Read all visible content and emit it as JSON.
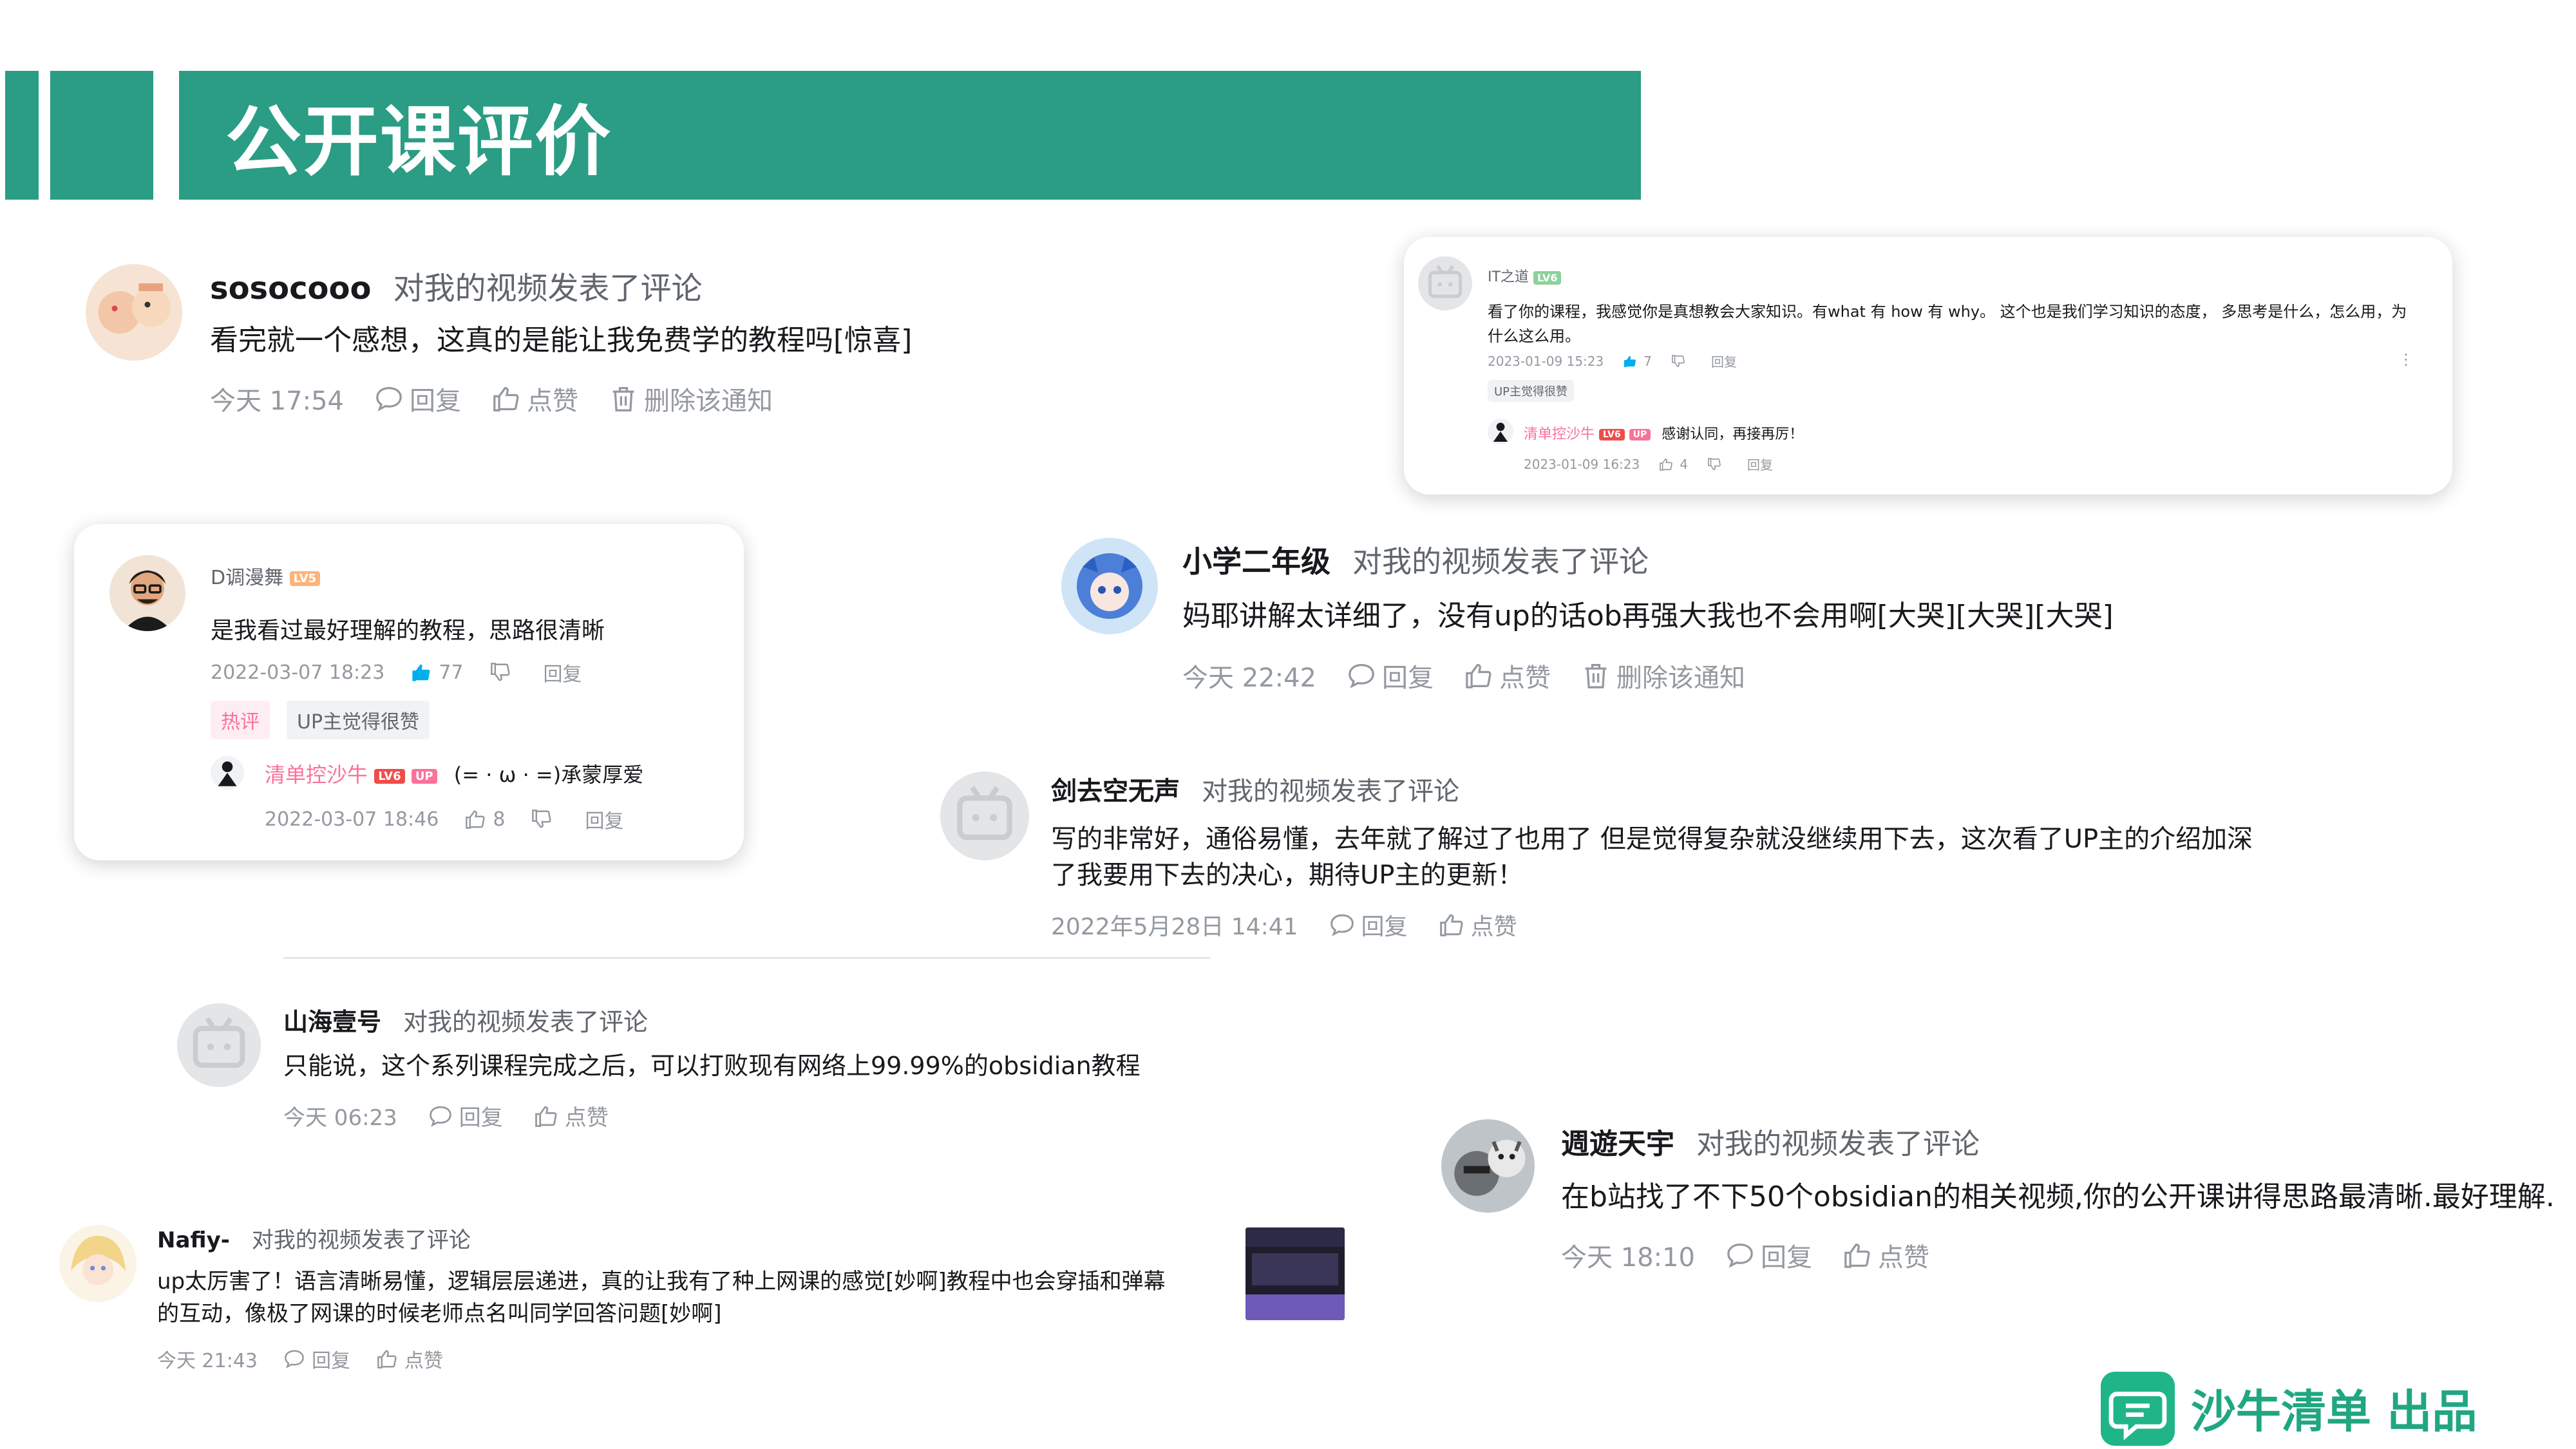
{
  "header": {
    "title": "公开课评价"
  },
  "action_text": "对我的视频发表了评论",
  "reply_label": "回复",
  "like_label": "点赞",
  "delete_label": "删除该通知",
  "comments": {
    "sosocooo": {
      "user": "sosocooo",
      "text": "看完就一个感想，这真的是能让我免费学的教程吗[惊喜]",
      "time": "今天 17:54"
    },
    "xiaoxue": {
      "user": "小学二年级",
      "text": "妈耶讲解太详细了，没有up的话ob再强大我也不会用啊[大哭][大哭][大哭]",
      "time": "今天 22:42"
    },
    "jianqu": {
      "user": "剑去空无声",
      "text_line1": "写的非常好，通俗易懂，去年就了解过了也用了 但是觉得复杂就没继续用下去，这次看了UP主的介绍加深",
      "text_line2": "了我要用下去的决心，期待UP主的更新！",
      "time": "2022年5月28日 14:41"
    },
    "shanhai": {
      "user": "山海壹号",
      "text": "只能说，这个系列课程完成之后，可以打败现有网络上99.99%的obsidian教程",
      "time": "今天 06:23"
    },
    "nafiy": {
      "user": "Nafiy-",
      "text_line1": "up太厉害了！语言清晰易懂，逻辑层层递进，真的让我有了种上网课的感觉[妙啊]教程中也会穿插和弹幕",
      "text_line2": "的互动，像极了网课的时候老师点名叫同学回答问题[妙啊]",
      "time": "今天 21:43"
    },
    "zhouyou": {
      "user": "週遊天宇",
      "text": "在b站找了不下50个obsidian的相关视频,你的公开课讲得思路最清晰.最好理解.",
      "time": "今天 18:10"
    }
  },
  "card_it": {
    "user": "IT之道",
    "level": "LV6",
    "text_line1": "看了你的课程，我感觉你是真想教会大家知识。有what 有 how 有 why。 这个也是我们学习知识的态度， 多思考是什么，怎么用，为",
    "text_line2": "什么这么用。",
    "time": "2023-01-09 15:23",
    "likes": "7",
    "reply": "回复",
    "tag": "UP主觉得很赞",
    "reply_user": "清单控沙牛",
    "reply_level": "LV6",
    "reply_up": "UP",
    "reply_text": "感谢认同，再接再厉！",
    "reply_time": "2023-01-09 16:23",
    "reply_likes": "4",
    "reply_reply": "回复"
  },
  "card_d": {
    "user": "D调漫舞",
    "level": "LV5",
    "text": "是我看过最好理解的教程，思路很清晰",
    "time": "2022-03-07 18:23",
    "likes": "77",
    "reply": "回复",
    "tag_hot": "热评",
    "tag_up": "UP主觉得很赞",
    "reply_user": "清单控沙牛",
    "reply_level": "LV6",
    "reply_up": "UP",
    "reply_text": "(= · ω · =)承蒙厚爱",
    "reply_time": "2022-03-07 18:46",
    "reply_likes": "8",
    "reply_reply": "回复"
  },
  "footer": {
    "brand": "沙牛清单 出品"
  },
  "colors": {
    "accent": "#2a9d84",
    "brand_green": "#20a781",
    "bili_pink": "#fb7299",
    "bili_blue": "#00aeec"
  }
}
